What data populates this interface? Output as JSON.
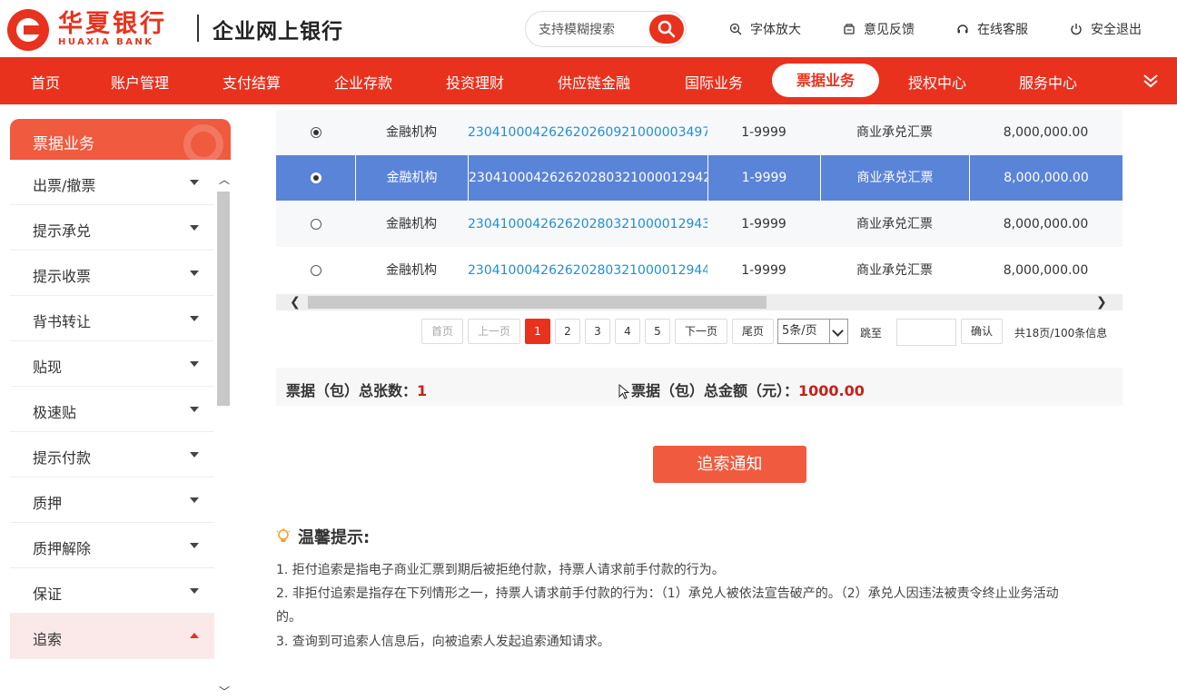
{
  "brand": {
    "name_cn": "华夏银行",
    "name_en": "HUAXIA BANK",
    "subtitle": "企业网上银行",
    "color": "#e8321e"
  },
  "search": {
    "placeholder": "支持模糊搜索"
  },
  "top_links": [
    {
      "icon": "zoom-in-icon",
      "label": "字体放大"
    },
    {
      "icon": "feedback-icon",
      "label": "意见反馈"
    },
    {
      "icon": "headset-icon",
      "label": "在线客服"
    },
    {
      "icon": "power-icon",
      "label": "安全退出"
    }
  ],
  "nav": {
    "items": [
      "首页",
      "账户管理",
      "支付结算",
      "企业存款",
      "投资理财",
      "供应链金融",
      "国际业务",
      "票据业务",
      "授权中心",
      "服务中心"
    ],
    "active": "票据业务"
  },
  "sidebar": {
    "title": "票据业务",
    "items": [
      "出票/撤票",
      "提示承兑",
      "提示收票",
      "背书转让",
      "贴现",
      "极速贴",
      "提示付款",
      "质押",
      "质押解除",
      "保证",
      "追索"
    ],
    "active": "追索"
  },
  "table": {
    "rows": [
      {
        "selected_radio": true,
        "highlight": false,
        "type": "金融机构",
        "bill_no": "23041000426262026092100000 3497",
        "range": "1-9999",
        "bill_kind": "商业承兑汇票",
        "amount": "8,000,000.00"
      },
      {
        "selected_radio": false,
        "highlight": true,
        "type": "金融机构",
        "bill_no": "230410004262620280321000012942",
        "range": "1-9999",
        "bill_kind": "商业承兑汇票",
        "amount": "8,000,000.00"
      },
      {
        "selected_radio": false,
        "highlight": false,
        "type": "金融机构",
        "bill_no": "230410004262620280321000012943",
        "range": "1-9999",
        "bill_kind": "商业承兑汇票",
        "amount": "8,000,000.00"
      },
      {
        "selected_radio": false,
        "highlight": false,
        "type": "金融机构",
        "bill_no": "230410004262620280321000012944",
        "range": "1-9999",
        "bill_kind": "商业承兑汇票",
        "amount": "8,000,000.00"
      }
    ]
  },
  "pagination": {
    "first": "首页",
    "prev": "上一页",
    "pages": [
      "1",
      "2",
      "3",
      "4",
      "5"
    ],
    "current": "1",
    "next": "下一页",
    "last": "尾页",
    "page_size": "5条/页",
    "jump_label": "跳至",
    "confirm": "确认",
    "info": "共18页/100条信息"
  },
  "summary": {
    "count_label": "票据（包）总张数：",
    "count_value": "1",
    "amount_label": "票据（包）总金额（元）：",
    "amount_value": "1000.00"
  },
  "action_button": "追索通知",
  "tips": {
    "title": "温馨提示:",
    "lines": [
      "1. 拒付追索是指电子商业汇票到期后被拒绝付款，持票人请求前手付款的行为。",
      "2. 非拒付追索是指存在下列情形之一，持票人请求前手付款的行为：（1）承兑人被依法宣告破产的。（2）承兑人因违法被责令终止业务活动",
      "的。",
      "3. 查询到可追索人信息后，向被追索人发起追索通知请求。"
    ]
  }
}
